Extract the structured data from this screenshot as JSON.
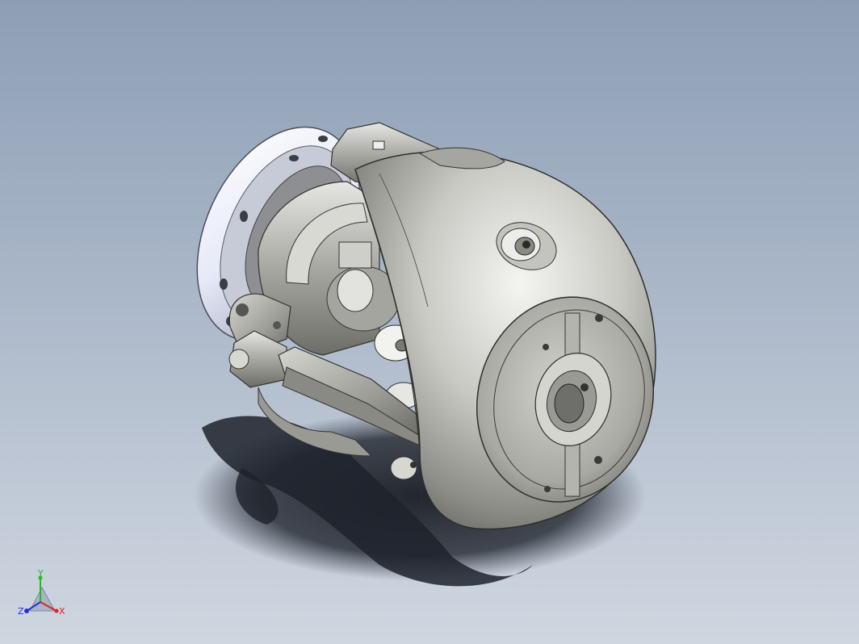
{
  "viewport": {
    "background_top": "#8e9fb4",
    "background_bottom": "#cfd6e0"
  },
  "model": {
    "body_color": "#b9b9b3",
    "flange_color": "#e9ecf8"
  },
  "triad": {
    "y_label": "Y",
    "x_label": "X",
    "z_label": "Z",
    "y_color": "#22bb22",
    "x_color": "#dd2222",
    "z_color": "#2233dd"
  }
}
